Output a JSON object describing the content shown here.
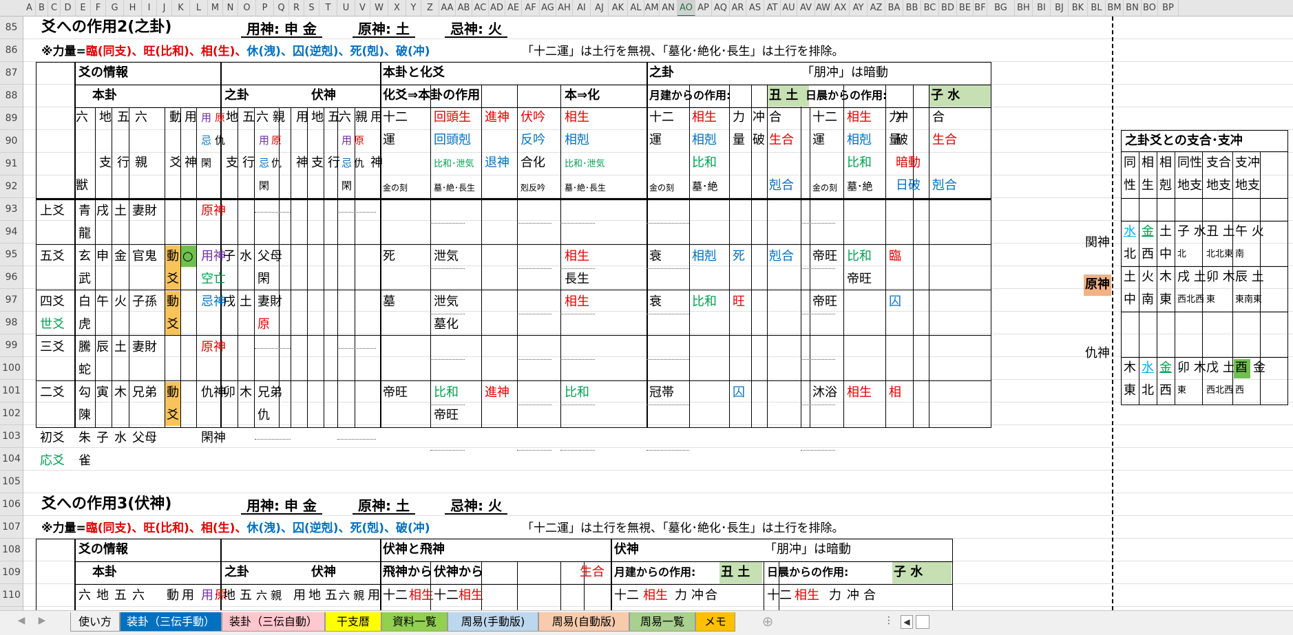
{
  "columns": [
    "A",
    "B",
    "C",
    "D",
    "E",
    "F",
    "G",
    "H",
    "I",
    "J",
    "K",
    "L",
    "M",
    "N",
    "O",
    "P",
    "Q",
    "R",
    "S",
    "T",
    "U",
    "V",
    "W",
    "X",
    "Y",
    "Z",
    "AA",
    "AB",
    "AC",
    "AD",
    "AE",
    "AF",
    "AG",
    "AH",
    "AI",
    "AJ",
    "AK",
    "AL",
    "AM",
    "AN",
    "AO",
    "AP",
    "AQ",
    "AR",
    "AS",
    "AT",
    "AU",
    "AV",
    "AW",
    "AX",
    "AY",
    "AZ",
    "BA",
    "BB",
    "BC",
    "BD",
    "BE",
    "BF",
    "BG",
    "BH",
    "BI",
    "BJ",
    "BK",
    "BL",
    "BM",
    "BN",
    "BO",
    "BP"
  ],
  "selected_column": "AO",
  "rows": [
    "85",
    "86",
    "87",
    "88",
    "89",
    "90",
    "91",
    "92",
    "93",
    "94",
    "95",
    "96",
    "97",
    "98",
    "99",
    "100",
    "101",
    "102",
    "103",
    "104",
    "105",
    "106",
    "107",
    "108",
    "109",
    "110"
  ],
  "section2": {
    "title": "爻への作用2(之卦)",
    "yojin": "用神: 申 金",
    "genjin": "原神: 土",
    "kijin": "忌神: 火",
    "note_prefix": "※力量=",
    "note_rin": "臨(同支)、旺(比和)、相(生)、",
    "note_kyu": "休(洩)、囚(逆剋)、死(剋)、破(冲)",
    "note_tail": "「十二運」は土行を無視、「墓化･絶化･長生」は土行を排除。"
  },
  "section3": {
    "title": "爻への作用3(伏神)",
    "yojin": "用神: 申 金",
    "genjin": "原神: 土",
    "kijin": "忌神: 火",
    "note_prefix": "※力量=",
    "note_rin": "臨(同支)、旺(比和)、相(生)、",
    "note_kyu": "休(洩)、囚(逆剋)、死(剋)、破(冲)",
    "note_tail": "「十二運」は土行を無視、「墓化･絶化･長生」は土行を排除。"
  },
  "table": {
    "h_kou_info": "爻の情報",
    "h_honka": "本卦",
    "h_shika": "之卦",
    "h_fukujin": "伏神",
    "h_honka_kahen": "本卦と化爻",
    "h_kakou_act": "化爻⇒本卦の作用",
    "h_hon_ka": "本⇒化",
    "h_shika2": "之卦",
    "h_houchu": "「朋冲」は暗動",
    "h_getsu": "月建からの作用:",
    "getsu_val": "丑 土",
    "h_nisshin": "日晨からの作用:",
    "nisshin_val": "子 水",
    "c_liu": "六",
    "c_ju": "獣",
    "c_chi": "地",
    "c_shi": "支",
    "c_go": "五",
    "c_gyo": "行",
    "c_roku": "六",
    "c_shin": "親",
    "c_do": "動",
    "c_kou": "爻",
    "c_yo": "用",
    "c_jin": "神",
    "c_yo2": "用",
    "c_gen": "原",
    "c_ki": "忌",
    "c_kyu": "仇",
    "c_kan": "閑",
    "c_rokushin": "六 親",
    "c_juuni": "十二",
    "c_un": "運",
    "c_kaitousei": "回頭生",
    "c_kaitoukoku": "回頭剋",
    "c_hiwa": "比和･泄気",
    "c_kin": "金の刻",
    "c_bo": "墓･絶･長生",
    "c_shinjin": "進神",
    "c_taijin": "退神",
    "c_fukugin": "伏吟",
    "c_hangin": "反吟",
    "c_gouka": "合化",
    "c_kokuhangin": "剋反吟",
    "c_sousei": "相生",
    "c_soukoku": "相剋",
    "c_hiwa2": "比和･泄気",
    "c_sousei2": "相生",
    "c_soukoku2": "相剋",
    "c_hiwa3": "比和",
    "c_bozetsu": "墓･絶",
    "c_riki": "力",
    "c_ryou": "量",
    "c_chu": "冲",
    "c_ha": "破",
    "c_gou": "合",
    "c_seigou": "生合",
    "c_kokugou": "剋合",
    "c_anndou": "暗動",
    "c_nippa": "日破"
  },
  "rowsdata": {
    "r93": {
      "pos": "上爻",
      "beast1": "青",
      "beast2": "龍",
      "chi": "戌",
      "go": "土",
      "rel": "妻財",
      "role": "原神"
    },
    "r95": {
      "pos": "五爻",
      "beast1": "玄",
      "beast2": "武",
      "chi": "申",
      "go": "金",
      "rel": "官鬼",
      "do1": "動",
      "do2": "爻",
      "yo": "○",
      "role": "用神",
      "role2": "空亡",
      "s_chi": "子",
      "s_go": "水",
      "s_rel": "父母",
      "s_role": "閑",
      "un": "死",
      "act": "泄気",
      "hon": "相生",
      "hon2": "長生",
      "m_un": "衰",
      "m_act": "相剋",
      "m_rk": "死",
      "m_gou": "剋合",
      "d_un": "帝旺",
      "d_act": "比和",
      "d_act2": "帝旺",
      "d_rk": "臨"
    },
    "r97": {
      "pos": "四爻",
      "pos2": "世爻",
      "beast1": "白",
      "beast2": "虎",
      "chi": "午",
      "go": "火",
      "rel": "子孫",
      "do1": "動",
      "do2": "爻",
      "role": "忌神",
      "s_chi": "戌",
      "s_go": "土",
      "s_rel": "妻財",
      "s_role": "原",
      "un": "墓",
      "act2": "墓化",
      "act": "泄気",
      "hon": "相生",
      "m_un": "衰",
      "m_act": "比和",
      "m_rk": "旺",
      "d_un": "帝旺",
      "d_rk": "囚"
    },
    "r99": {
      "pos": "三爻",
      "beast1": "騰",
      "beast2": "蛇",
      "chi": "辰",
      "go": "土",
      "rel": "妻財",
      "role": "原神"
    },
    "r101": {
      "pos": "二爻",
      "beast1": "勾",
      "beast2": "陳",
      "chi": "寅",
      "go": "木",
      "rel": "兄弟",
      "do1": "動",
      "do2": "爻",
      "role": "仇神",
      "s_chi": "卯",
      "s_go": "木",
      "s_rel": "兄弟",
      "s_role": "仇",
      "un": "帝旺",
      "act": "比和",
      "act2": "帝旺",
      "shin": "進神",
      "hon": "比和",
      "m_un": "冠帯",
      "m_rk": "囚",
      "d_un": "沐浴",
      "d_act": "相生",
      "d_rk": "相"
    },
    "r103": {
      "pos": "初爻",
      "pos2": "応爻",
      "beast1": "朱",
      "beast2": "雀",
      "chi": "子",
      "go": "水",
      "rel": "父母",
      "role": "閑神"
    }
  },
  "side": {
    "title": "之卦爻との支合･支冲",
    "h": [
      "同",
      "相",
      "相",
      "同性",
      "支合",
      "支冲"
    ],
    "h2": [
      "性",
      "生",
      "剋",
      "地支",
      "地支",
      "地支"
    ],
    "r95label": "関神",
    "r95": [
      "水",
      "金",
      "土",
      "子 水",
      "丑 土",
      "午 火"
    ],
    "r96": [
      "北",
      "西",
      "中",
      "北",
      "北北東",
      "南"
    ],
    "r97label": "原神",
    "r97": [
      "土",
      "火",
      "木",
      "戌 土",
      "卯 木",
      "辰 土"
    ],
    "r98": [
      "中",
      "南",
      "東",
      "西北西",
      "東",
      "東南東"
    ],
    "r101label": "仇神",
    "r101": [
      "木",
      "水",
      "金",
      "卯 木",
      "戊 土",
      "酉",
      "金"
    ],
    "r102": [
      "東",
      "北",
      "西",
      "東",
      "西北西",
      "西"
    ]
  },
  "t3": {
    "h_kou_info": "爻の情報",
    "h_fuku_hi": "伏神と飛神",
    "h_fukujin": "伏神",
    "h_houchu": "「朋冲」は暗動",
    "h_honka": "本卦",
    "h_shika": "之卦",
    "h_fuku": "伏神",
    "h_hijin_kara": "飛神から",
    "h_fukujin_kara": "伏神から",
    "h_seigou": "生合",
    "h_getsu": "月建からの作用:",
    "getsu_val": "丑 土",
    "h_nisshin": "日晨からの作用:",
    "nisshin_val": "子 水",
    "r110": [
      "六",
      "地",
      "五",
      "六",
      "動",
      "用",
      "用･",
      "原",
      "地",
      "五",
      "六 親",
      "用",
      "地",
      "五",
      "六 親",
      "用",
      "十二",
      "相生",
      "十二",
      "相生",
      "十二",
      "相生",
      "力",
      "冲",
      "合",
      "十二",
      "相生",
      "力",
      "冲",
      "合"
    ]
  },
  "tabs": [
    {
      "label": "使い方",
      "bg": "#f0f0f0",
      "color": "#000"
    },
    {
      "label": "装卦（三伝手動）",
      "bg": "#0070c0",
      "color": "#fff"
    },
    {
      "label": "装卦（三伝自動）",
      "bg": "#ffc7ce",
      "color": "#000"
    },
    {
      "label": "干支暦",
      "bg": "#ffff00",
      "color": "#000"
    },
    {
      "label": "資料一覧",
      "bg": "#92d050",
      "color": "#000"
    },
    {
      "label": "周易(手動版)",
      "bg": "#bdd7ee",
      "color": "#000"
    },
    {
      "label": "周易(自動版)",
      "bg": "#f8cbad",
      "color": "#000"
    },
    {
      "label": "周易一覧",
      "bg": "#a9d08e",
      "color": "#000"
    },
    {
      "label": "メモ",
      "bg": "#ffc000",
      "color": "#000"
    }
  ]
}
